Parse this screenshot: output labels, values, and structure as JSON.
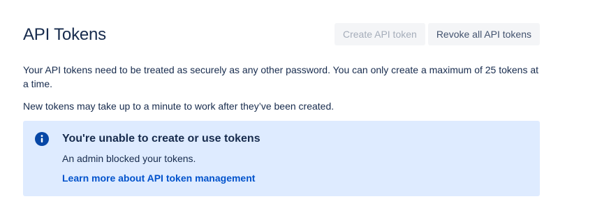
{
  "header": {
    "title": "API Tokens",
    "create_label": "Create API token",
    "revoke_label": "Revoke all API tokens"
  },
  "description": "Your API tokens need to be treated as securely as any other password. You can only create a maximum of 25 tokens at a time.",
  "note": "New tokens may take up to a minute to work after they’ve been created.",
  "banner": {
    "icon": "info-icon",
    "title": "You're unable to create or use tokens",
    "body": "An admin blocked your tokens.",
    "link_label": "Learn more about API token management"
  },
  "colors": {
    "banner_background": "#deebff",
    "info_icon": "#0747a6",
    "link": "#0052cc",
    "disabled_text": "#a5adba"
  }
}
